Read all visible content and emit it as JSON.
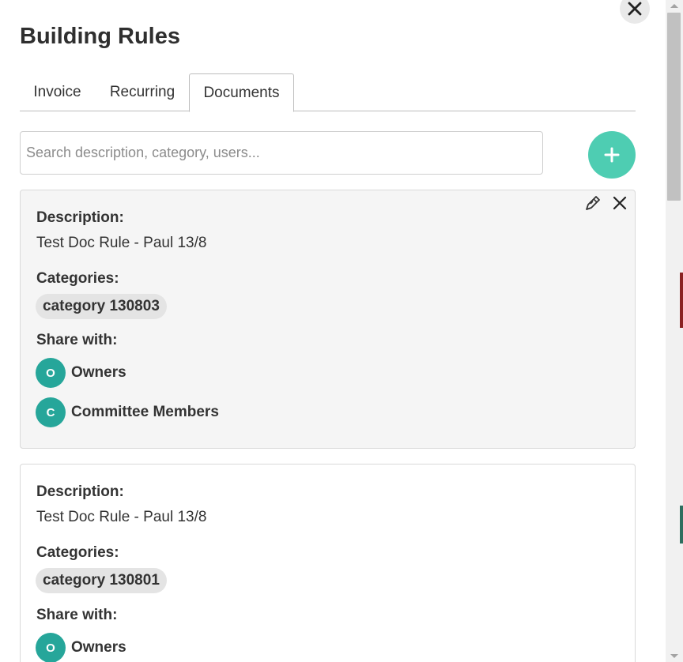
{
  "modal": {
    "title": "Building Rules"
  },
  "tabs": [
    {
      "label": "Invoice",
      "active": false
    },
    {
      "label": "Recurring",
      "active": false
    },
    {
      "label": "Documents",
      "active": true
    }
  ],
  "search": {
    "placeholder": "Search description, category, users...",
    "value": ""
  },
  "icons": {
    "close": "close-icon",
    "add": "plus-icon",
    "edit": "pencil-icon",
    "delete": "close-icon"
  },
  "colors": {
    "accent": "#4ecdb2",
    "avatar": "#26a69a",
    "chip": "#e4e4e4",
    "card_highlight": "#f5f5f5"
  },
  "cards": [
    {
      "description_label": "Description:",
      "description": "Test Doc Rule - Paul 13/8",
      "categories_label": "Categories:",
      "categories": [
        "category 130803"
      ],
      "share_label": "Share with:",
      "share": [
        {
          "initial": "O",
          "name": "Owners"
        },
        {
          "initial": "C",
          "name": "Committee Members"
        }
      ]
    },
    {
      "description_label": "Description:",
      "description": "Test Doc Rule - Paul 13/8",
      "categories_label": "Categories:",
      "categories": [
        "category 130801"
      ],
      "share_label": "Share with:",
      "share": [
        {
          "initial": "O",
          "name": "Owners"
        }
      ]
    }
  ]
}
